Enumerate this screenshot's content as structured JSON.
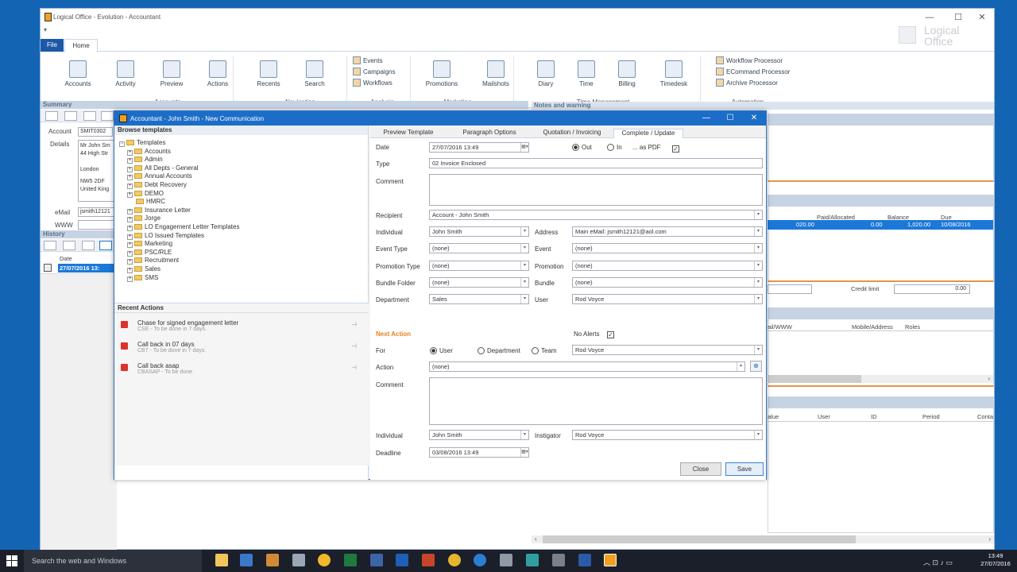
{
  "window": {
    "title": "Logical Office - Evolution - Accountant"
  },
  "tabs": {
    "file": "File",
    "home": "Home"
  },
  "ribbon": {
    "accounts_group": "Accounts",
    "navigation_group": "Navigation",
    "analysis_group": "Analysis",
    "marketing_group": "Marketing",
    "time_group": "Time Management",
    "automation_group": "Automation",
    "buttons": [
      "Accounts",
      "Activity",
      "Preview",
      "Actions",
      "Recents",
      "Search",
      "Promotions",
      "Mailshots",
      "Diary",
      "Time",
      "Billing",
      "Timedesk"
    ],
    "analysis_items": [
      "Events",
      "Campaigns",
      "Workflows"
    ],
    "automation_items": [
      "Workflow Processor",
      "ECommand Processor",
      "Archive Processor"
    ],
    "logo_line1": "Logical",
    "logo_line2": "Office"
  },
  "summary": {
    "header": "Summary",
    "account_label": "Account",
    "account_value": "SMIT0302",
    "details_label": "Details",
    "address": [
      "Mr John Sm",
      "44 High Str",
      "",
      "London",
      "",
      "NW5 2DF",
      "United King"
    ],
    "email_label": "eMail",
    "email_value": "jsmith12121",
    "www_label": "WWW"
  },
  "history": {
    "header": "History",
    "col_date": "Date",
    "row_date": "27/07/2016 13:"
  },
  "notes": {
    "header": "Notes and warning"
  },
  "right_grid": {
    "cols": [
      "Paid/Allocated",
      "Balance",
      "Due"
    ],
    "row": [
      "020.00",
      "0.00",
      "1,020.00",
      "10/08/2016"
    ],
    "credit_label": "Credit limit",
    "credit_value": "0.00",
    "contact_cols": [
      "ail/WWW",
      "Mobile/Address",
      "Roles"
    ],
    "bottom_cols": [
      "alue",
      "User",
      "ID",
      "Period",
      "Conta"
    ]
  },
  "dialog": {
    "title": "Accountant - John Smith - New Communication",
    "browse_header": "Browse templates",
    "tree_root": "Templates",
    "tree_items": [
      "Accounts",
      "Admin",
      "All Depts - General",
      "Annual Accounts",
      "Debt Recovery",
      "DEMO",
      "HMRC",
      "Insurance Letter",
      "Jorge",
      "LO Engagement Letter Templates",
      "LO Issued Templates",
      "Marketing",
      "PSC/RLE",
      "Recruitment",
      "Sales",
      "SMS"
    ],
    "recent_header": "Recent Actions",
    "recent": [
      {
        "title": "Chase for signed engagement letter",
        "sub": "CSE - To be done  in 7 days."
      },
      {
        "title": "Call back in 07 days",
        "sub": "CB7 - To be done  in 7 days."
      },
      {
        "title": "Call back asap",
        "sub": "CBASAP - To be done"
      }
    ],
    "tabs": [
      "Preview Template",
      "Paragraph Options",
      "Quotation / Invoicing",
      "Complete / Update"
    ],
    "form": {
      "date_label": "Date",
      "date_value": "27/07/2016 13:49",
      "out_label": "Out",
      "in_label": "In",
      "pdf_label": "... as PDF",
      "type_label": "Type",
      "type_value": "02 Invoice Enclosed",
      "comment_label": "Comment",
      "recipient_label": "Recipient",
      "recipient_value": "Account - John Smith",
      "individual_label": "Individual",
      "individual_value": "John Smith",
      "address_label": "Address",
      "address_value": "Main eMail: jsmith12121@aol.com",
      "event_type_label": "Event Type",
      "event_type_value": "(none)",
      "event_label": "Event",
      "event_value": "(none)",
      "promo_type_label": "Promotion Type",
      "promo_type_value": "(none)",
      "promo_label": "Promotion",
      "promo_value": "(none)",
      "bundle_folder_label": "Bundle Folder",
      "bundle_folder_value": "(none)",
      "bundle_label": "Bundle",
      "bundle_value": "(none)",
      "department_label": "Department",
      "department_value": "Sales",
      "user_label": "User",
      "user_value": "Rod Voyce",
      "next_action_label": "Next Action",
      "no_alerts_label": "No Alerts",
      "for_label": "For",
      "for_user": "User",
      "for_department": "Department",
      "for_team": "Team",
      "for_value": "Rod Voyce",
      "action_label": "Action",
      "action_value": "(none)",
      "comment2_label": "Comment",
      "individual2_label": "Individual",
      "individual2_value": "John Smith",
      "instigator_label": "Instigator",
      "instigator_value": "Rod Voyce",
      "deadline_label": "Deadline",
      "deadline_value": "03/08/2016 13:49"
    },
    "close_button": "Close",
    "save_button": "Save"
  },
  "taskbar": {
    "search_placeholder": "Search the web and Windows",
    "time": "13:49",
    "date": "27/07/2016"
  }
}
